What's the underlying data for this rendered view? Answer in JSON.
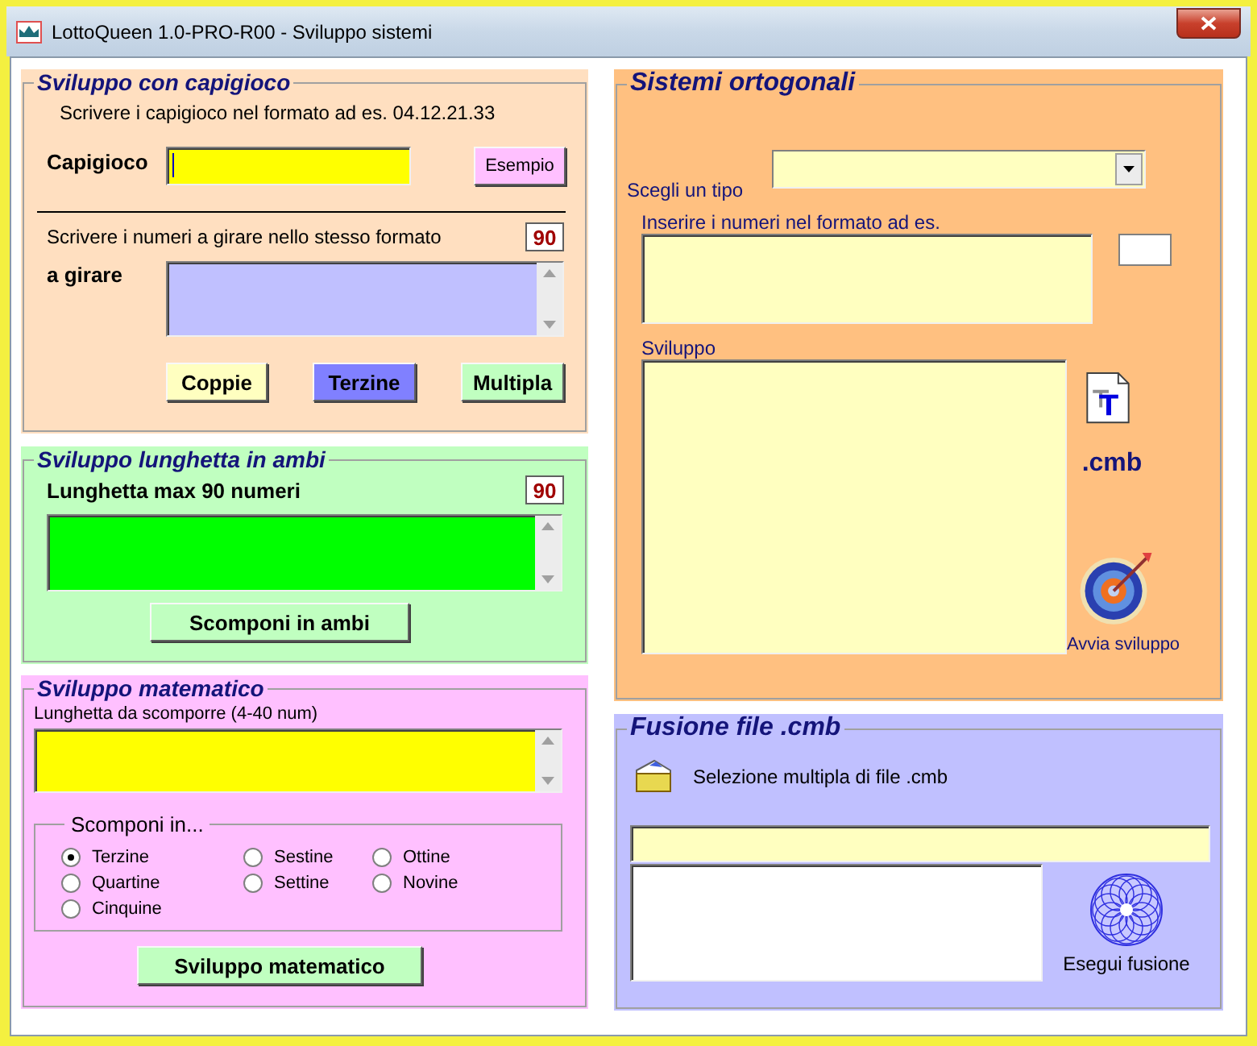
{
  "window": {
    "title": "LottoQueen 1.0-PRO-R00 - Sviluppo sistemi"
  },
  "capigioco": {
    "title": "Sviluppo con capigioco",
    "hint": "Scrivere i capigioco nel formato ad es. 04.12.21.33",
    "label": "Capigioco",
    "example_button": "Esempio",
    "numbers_hint": "Scrivere i numeri a girare nello stesso formato",
    "count": "90",
    "numbers_label": "a girare",
    "buttons": [
      {
        "label": "Coppie",
        "color": "#ffffc0"
      },
      {
        "label": "Terzine",
        "color": "#8080ff"
      },
      {
        "label": "Multipla",
        "color": "#c0ffc0"
      }
    ]
  },
  "lunghetta": {
    "title": "Sviluppo lunghetta in ambi",
    "label": "Lunghetta max 90 numeri",
    "count": "90",
    "button": "Scomponi in ambi"
  },
  "matematico": {
    "title": "Sviluppo matematico",
    "field_label": "Lunghetta da scomporre (4-40 num)",
    "group_title": "Scomponi in...",
    "option_columns": [
      [
        {
          "label": "Terzine",
          "selected": true
        },
        {
          "label": "Quartine",
          "selected": false
        },
        {
          "label": "Cinquine",
          "selected": false
        }
      ],
      [
        {
          "label": "Sestine",
          "selected": false
        },
        {
          "label": "Settine",
          "selected": false
        }
      ],
      [
        {
          "label": "Ottine",
          "selected": false
        },
        {
          "label": "Novine",
          "selected": false
        }
      ]
    ],
    "button": "Sviluppo matematico"
  },
  "ortogonali": {
    "title": "Sistemi ortogonali",
    "type_label": "Scegli un tipo",
    "numbers_label": "Inserire i numeri nel formato ad es.",
    "development_label": "Sviluppo",
    "cmb_label": ".cmb",
    "start_label": "Avvia sviluppo"
  },
  "fusione": {
    "title": "Fusione file .cmb",
    "select_label": "Selezione multipla di file .cmb",
    "merge_label": "Esegui fusione"
  }
}
